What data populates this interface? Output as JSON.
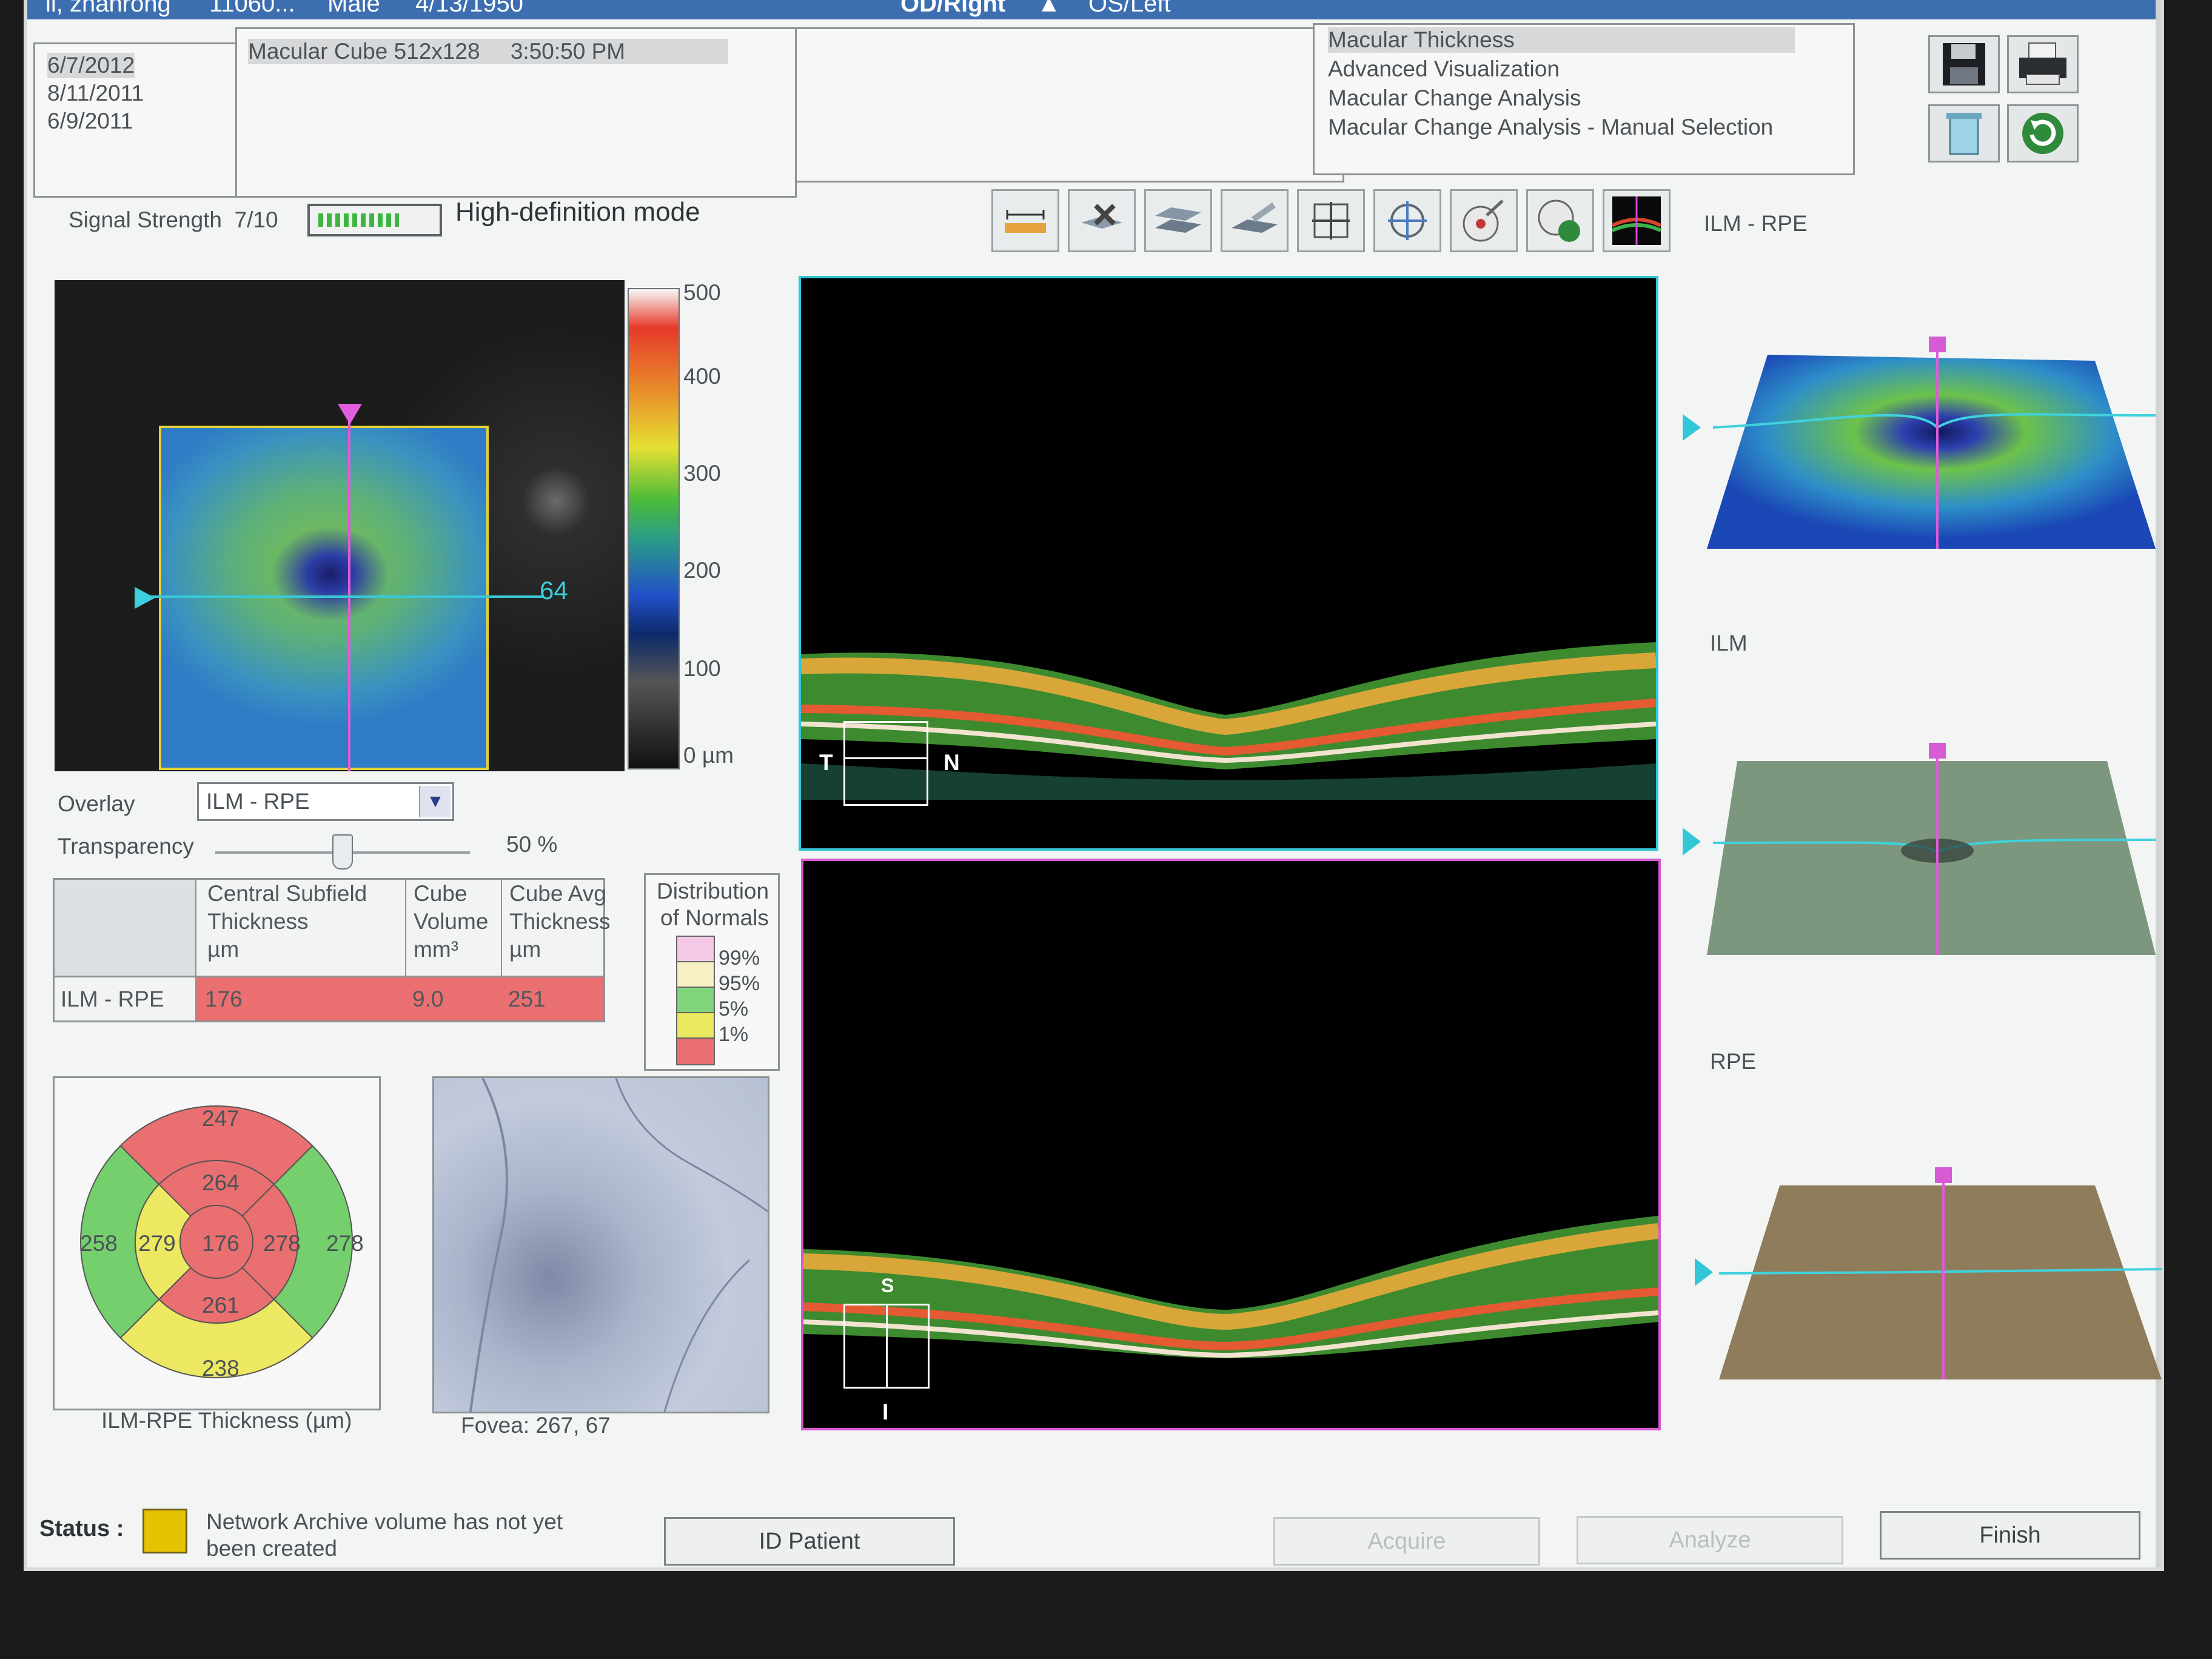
{
  "titlebar": {
    "patient_name": "li, zhanrong",
    "patient_id": "11060...",
    "sex": "Male",
    "dob": "4/13/1950",
    "eye_od": "OD/Right",
    "eye_os": "OS/Left"
  },
  "visits": [
    "6/7/2012",
    "8/11/2011",
    "6/9/2011"
  ],
  "scan_list": [
    {
      "name": "Macular Cube 512x128",
      "time": "3:50:50 PM"
    }
  ],
  "analyses": [
    "Macular Thickness",
    "Advanced Visualization",
    "Macular Change Analysis",
    "Macular Change Analysis - Manual Selection"
  ],
  "signal": {
    "label": "Signal Strength",
    "value": "7/10",
    "level": 0.7
  },
  "hd_mode": "High-definition mode",
  "layer_label": "ILM - RPE",
  "color_scale": {
    "ticks": [
      "500",
      "400",
      "300",
      "200",
      "100",
      "0 µm"
    ]
  },
  "fundus": {
    "h_line_label": "64"
  },
  "overlay": {
    "label": "Overlay",
    "value": "ILM - RPE"
  },
  "transparency": {
    "label": "Transparency",
    "value_text": "50 %",
    "value": 0.5
  },
  "thickness_table": {
    "headers": [
      [
        "Central Subfield",
        "Thickness",
        "µm"
      ],
      [
        "Cube",
        "Volume",
        "mm³"
      ],
      [
        "Cube Avg",
        "Thickness",
        "µm"
      ]
    ],
    "row_label": "ILM - RPE",
    "values": [
      "176",
      "9.0",
      "251"
    ]
  },
  "distribution": {
    "title_line1": "Distribution",
    "title_line2": "of Normals",
    "levels": [
      {
        "label": "99%",
        "color": "#f4c8e6"
      },
      {
        "label": "95%",
        "color": "#f6f0c2"
      },
      {
        "label": "5%",
        "color": "#7fd47c"
      },
      {
        "label": "1%",
        "color": "#e9e85f"
      },
      {
        "label": "",
        "color": "#ea6f70"
      }
    ]
  },
  "etdrs": {
    "caption": "ILM-RPE Thickness (µm)",
    "outer": {
      "superior": "247",
      "nasal": "278",
      "inferior": "238",
      "temporal": "258"
    },
    "inner": {
      "superior": "264",
      "nasal": "278",
      "inferior": "261",
      "temporal": "279"
    },
    "center": "176",
    "colors": {
      "red": "#ea6f70",
      "green": "#74cf6c",
      "yellow": "#ede862"
    }
  },
  "fovea": {
    "caption": "Fovea:  267, 67"
  },
  "bscan_top": {
    "left_label": "T",
    "right_label": "N"
  },
  "bscan_bottom": {
    "top_label": "S",
    "bottom_label": "I"
  },
  "surfaces": [
    {
      "label": "ILM - RPE"
    },
    {
      "label": "ILM"
    },
    {
      "label": "RPE"
    }
  ],
  "status": {
    "label": "Status :",
    "message_line1": "Network Archive volume has not yet",
    "message_line2": "been created",
    "color": "#e7c200"
  },
  "buttons": {
    "id_patient": "ID Patient",
    "acquire": "Acquire",
    "analyze": "Analyze",
    "finish": "Finish"
  }
}
